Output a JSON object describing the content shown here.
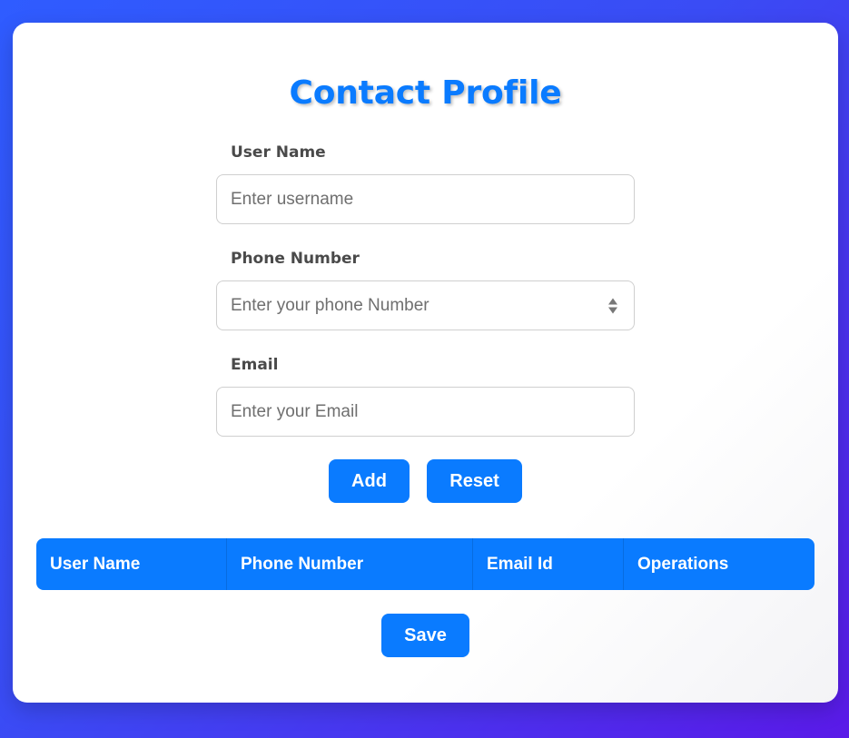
{
  "form": {
    "title": "Contact Profile",
    "fields": [
      {
        "label": "User Name",
        "placeholder": "Enter username"
      },
      {
        "label": "Phone Number",
        "placeholder": "Enter your phone Number"
      },
      {
        "label": "Email",
        "placeholder": "Enter your Email"
      }
    ],
    "add_label": "Add",
    "reset_label": "Reset"
  },
  "table": {
    "headers": [
      "User Name",
      "Phone Number",
      "Email Id",
      "Operations"
    ]
  },
  "save_label": "Save",
  "colors": {
    "accent": "#0a7bff",
    "background_start": "#2f5cff",
    "background_end": "#5a1ae8"
  },
  "icons": {
    "phone_spinner": "spinner-arrows-icon"
  }
}
